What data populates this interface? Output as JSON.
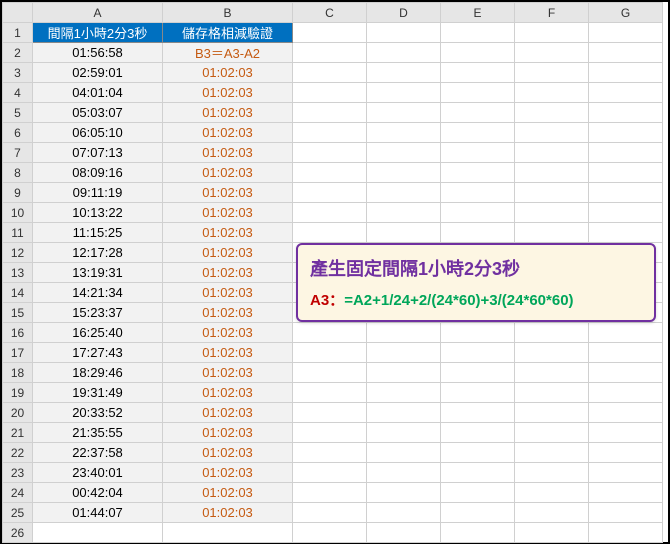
{
  "columns": [
    "",
    "A",
    "B",
    "C",
    "D",
    "E",
    "F",
    "G"
  ],
  "headers": {
    "a": "間隔1小時2分3秒",
    "b": "儲存格相減驗證"
  },
  "rows": [
    {
      "n": "2",
      "a": "01:56:58",
      "b": "B3＝A3-A2"
    },
    {
      "n": "3",
      "a": "02:59:01",
      "b": "01:02:03"
    },
    {
      "n": "4",
      "a": "04:01:04",
      "b": "01:02:03"
    },
    {
      "n": "5",
      "a": "05:03:07",
      "b": "01:02:03"
    },
    {
      "n": "6",
      "a": "06:05:10",
      "b": "01:02:03"
    },
    {
      "n": "7",
      "a": "07:07:13",
      "b": "01:02:03"
    },
    {
      "n": "8",
      "a": "08:09:16",
      "b": "01:02:03"
    },
    {
      "n": "9",
      "a": "09:11:19",
      "b": "01:02:03"
    },
    {
      "n": "10",
      "a": "10:13:22",
      "b": "01:02:03"
    },
    {
      "n": "11",
      "a": "11:15:25",
      "b": "01:02:03"
    },
    {
      "n": "12",
      "a": "12:17:28",
      "b": "01:02:03"
    },
    {
      "n": "13",
      "a": "13:19:31",
      "b": "01:02:03"
    },
    {
      "n": "14",
      "a": "14:21:34",
      "b": "01:02:03"
    },
    {
      "n": "15",
      "a": "15:23:37",
      "b": "01:02:03"
    },
    {
      "n": "16",
      "a": "16:25:40",
      "b": "01:02:03"
    },
    {
      "n": "17",
      "a": "17:27:43",
      "b": "01:02:03"
    },
    {
      "n": "18",
      "a": "18:29:46",
      "b": "01:02:03"
    },
    {
      "n": "19",
      "a": "19:31:49",
      "b": "01:02:03"
    },
    {
      "n": "20",
      "a": "20:33:52",
      "b": "01:02:03"
    },
    {
      "n": "21",
      "a": "21:35:55",
      "b": "01:02:03"
    },
    {
      "n": "22",
      "a": "22:37:58",
      "b": "01:02:03"
    },
    {
      "n": "23",
      "a": "23:40:01",
      "b": "01:02:03"
    },
    {
      "n": "24",
      "a": "00:42:04",
      "b": "01:02:03"
    },
    {
      "n": "25",
      "a": "01:44:07",
      "b": "01:02:03"
    },
    {
      "n": "26",
      "a": "",
      "b": ""
    }
  ],
  "tooltip": {
    "title": "產生固定間隔1小時2分3秒",
    "formula_ref": "A3：",
    "formula_body": "=A2+1/24+2/(24*60)+3/(24*60*60)"
  }
}
